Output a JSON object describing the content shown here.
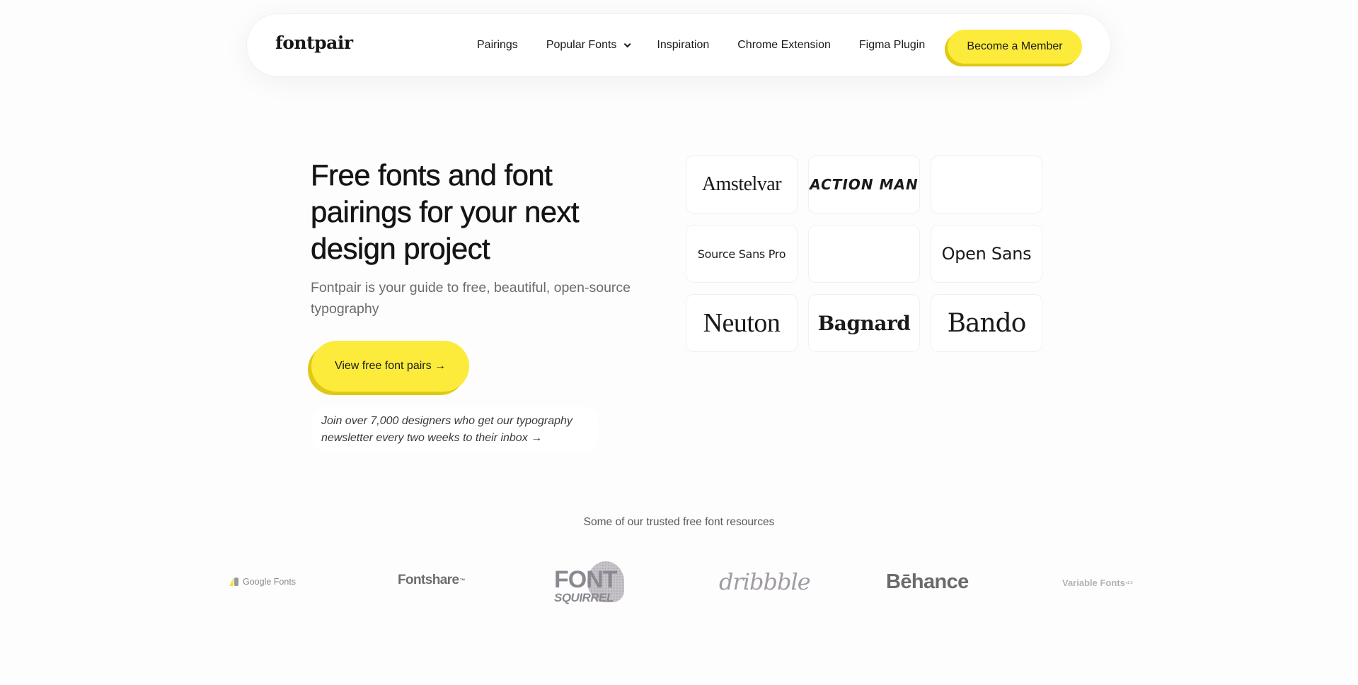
{
  "nav": {
    "logo": "fontpair",
    "links": [
      {
        "label": "Pairings"
      },
      {
        "label": "Popular Fonts",
        "has_dropdown": true
      },
      {
        "label": "Inspiration"
      },
      {
        "label": "Chrome Extension"
      },
      {
        "label": "Figma Plugin"
      }
    ],
    "member_button": "Become a Member"
  },
  "hero": {
    "title": "Free fonts and font pairings for your next design project",
    "subtitle": "Fontpair is your guide to free, beautiful, open-source typography",
    "cta_button": "View free font pairs →",
    "newsletter_text": "Join over 7,000 designers who get our typography newsletter every two weeks to their inbox →"
  },
  "font_grid": [
    {
      "name": "Amstelvar"
    },
    {
      "name": "ACTION MAN"
    },
    {
      "name": ""
    },
    {
      "name": "Source Sans Pro"
    },
    {
      "name": ""
    },
    {
      "name": "Open Sans"
    },
    {
      "name": "Neuton"
    },
    {
      "name": "Bagnard"
    },
    {
      "name": "Bando"
    }
  ],
  "resources": {
    "label": "Some of our trusted free font resources",
    "logos": [
      {
        "name": "Google Fonts"
      },
      {
        "name": "Fontshare",
        "mark": "™"
      },
      {
        "name": "FONT",
        "sub": "SQUIRREL"
      },
      {
        "name": "dribbble"
      },
      {
        "name": "Bēhance"
      },
      {
        "name": "Variable Fonts",
        "mark": "v2.0"
      }
    ]
  },
  "colors": {
    "accent_yellow": "#fceb3b",
    "accent_yellow_shadow": "#dfc915",
    "text_dark": "#141414",
    "text_muted": "#6b6b6b",
    "background": "#fdfdfe"
  }
}
